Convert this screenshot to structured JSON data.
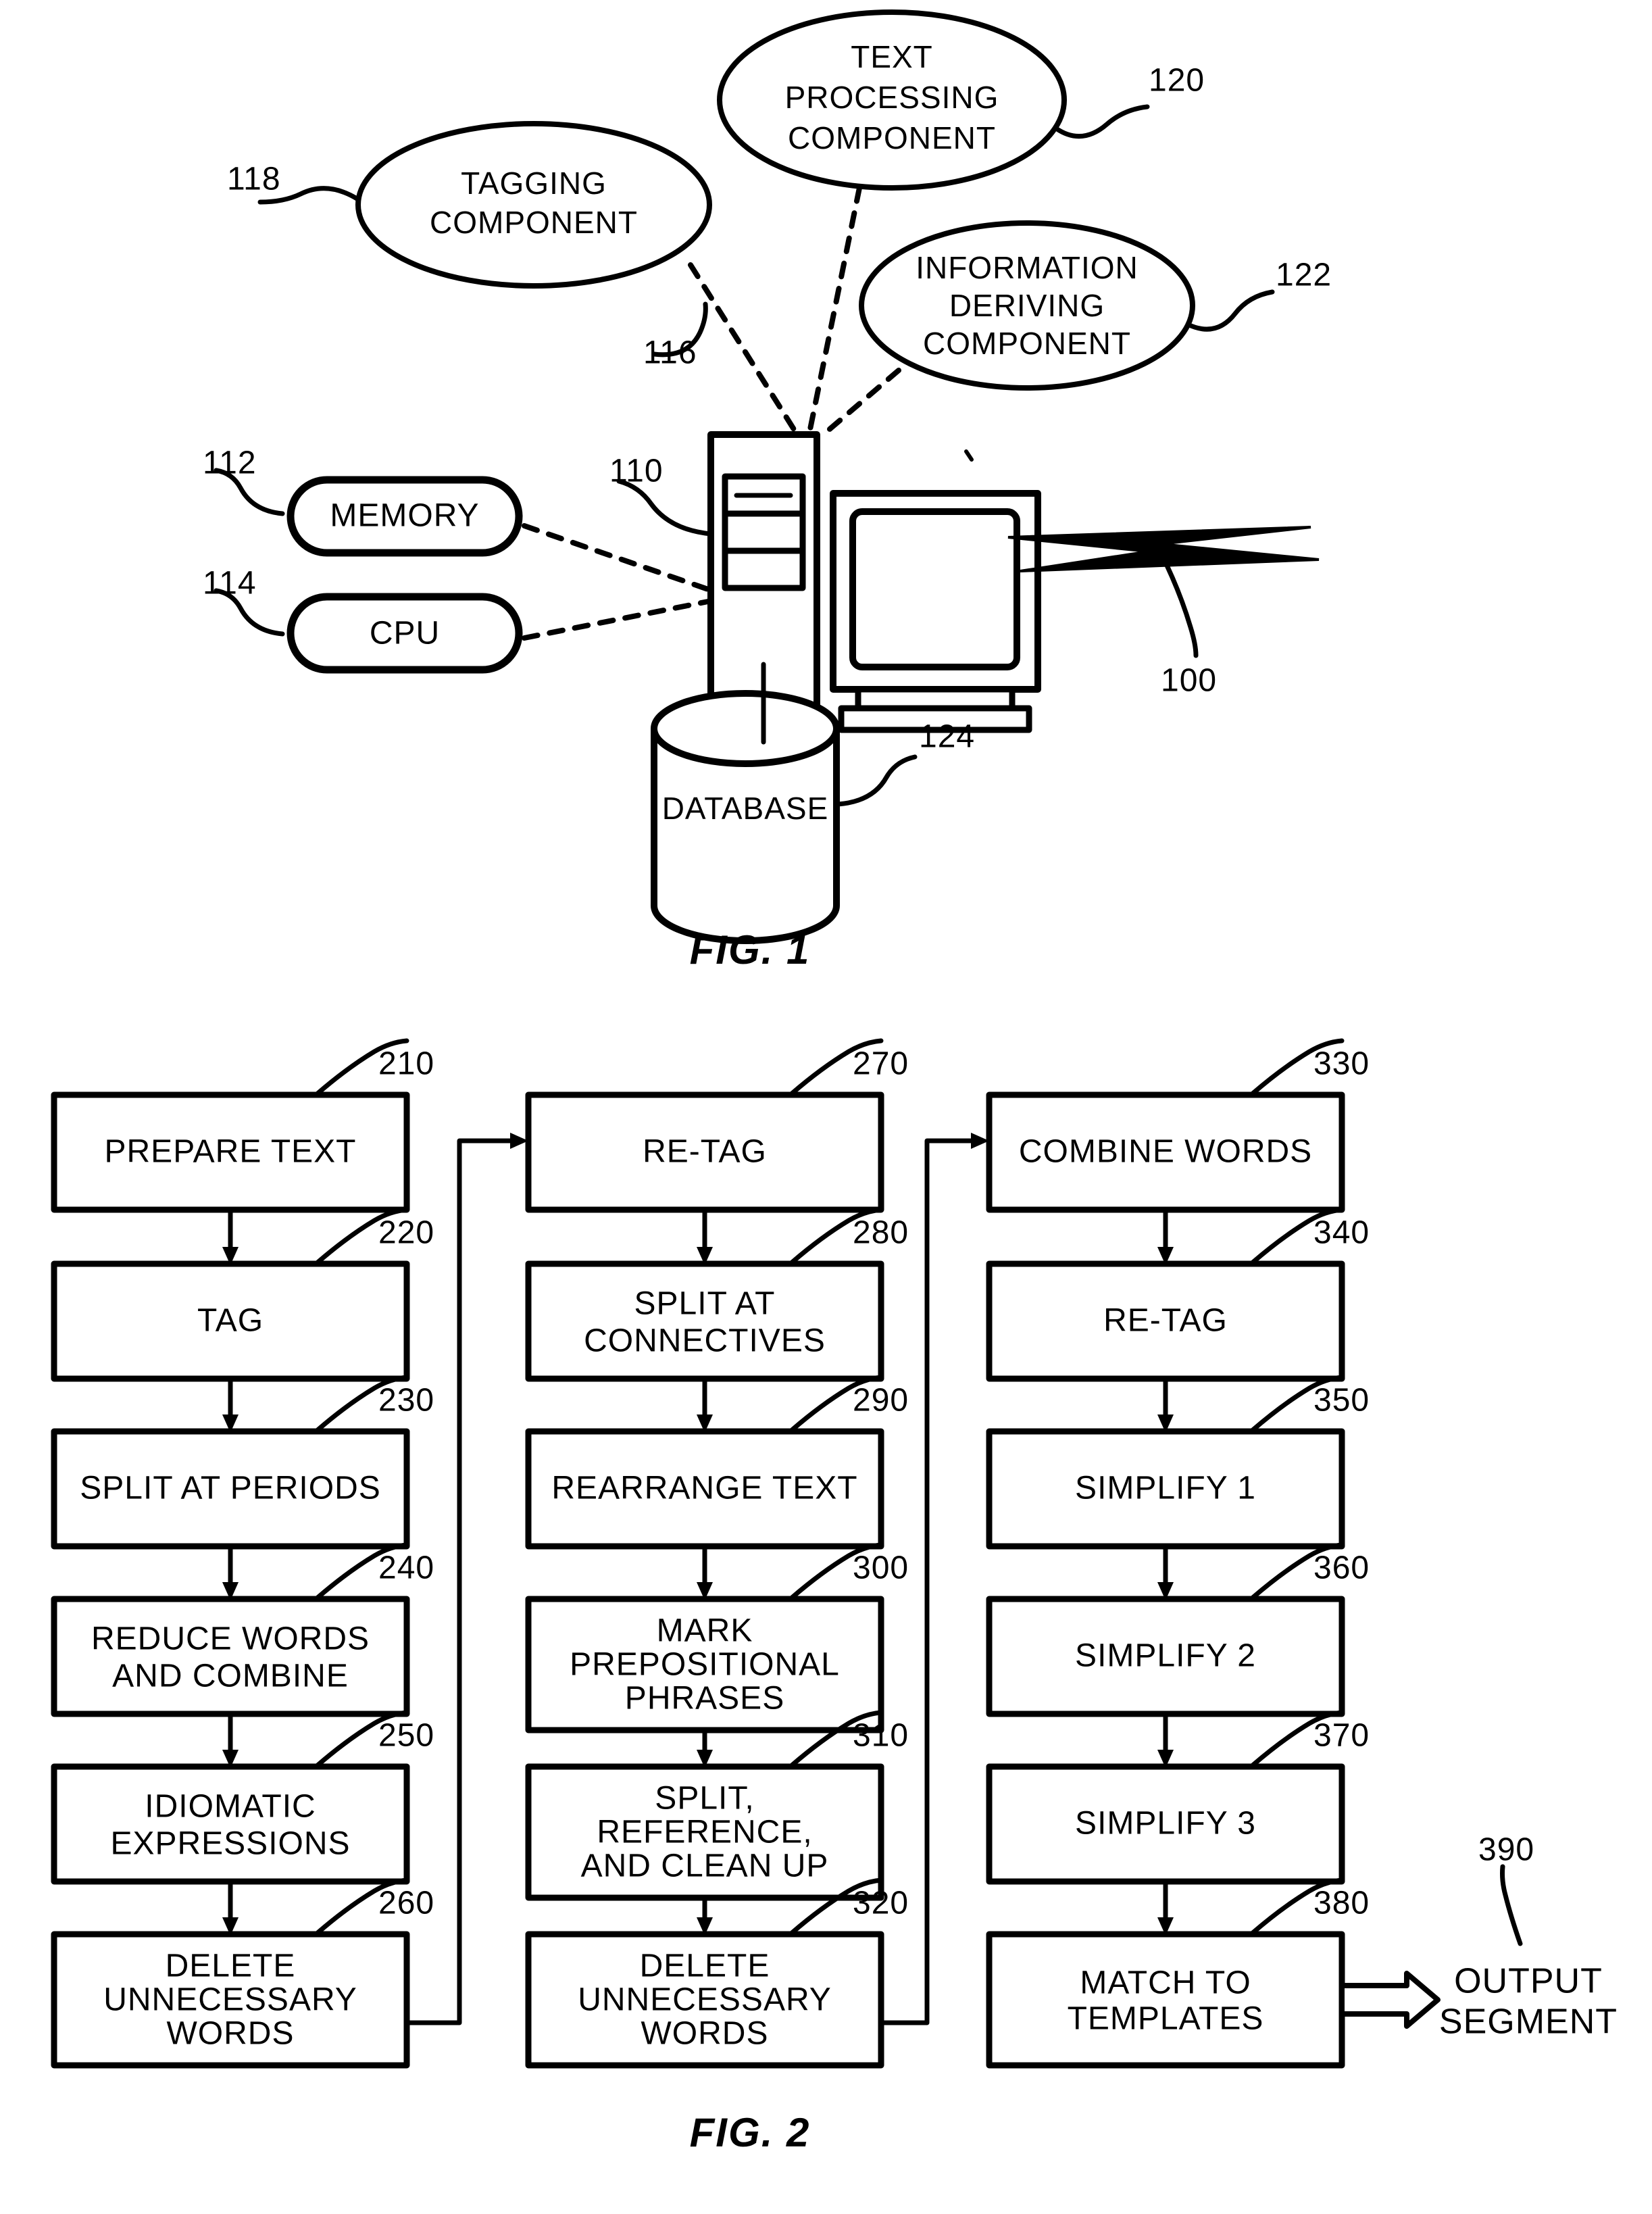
{
  "figure1": {
    "caption": "FIG. 1",
    "system_ref": "100",
    "nodes": {
      "tagging_component": {
        "label_line1": "TAGGING",
        "label_line2": "COMPONENT",
        "ref": "118"
      },
      "text_processing_component": {
        "label_line1": "TEXT",
        "label_line2": "PROCESSING",
        "label_line3": "COMPONENT",
        "ref": "120"
      },
      "information_deriving_component": {
        "label_line1": "INFORMATION",
        "label_line2": "DERIVING",
        "label_line3": "COMPONENT",
        "ref": "122"
      },
      "memory": {
        "label": "MEMORY",
        "ref": "112"
      },
      "cpu": {
        "label": "CPU",
        "ref": "114"
      },
      "computer": {
        "ref": "110"
      },
      "components_bundle": {
        "ref": "116"
      },
      "database": {
        "label": "DATABASE",
        "ref": "124"
      }
    }
  },
  "figure2": {
    "caption": "FIG. 2",
    "output": {
      "label_line1": "OUTPUT",
      "label_line2": "SEGMENT",
      "ref": "390"
    },
    "columns": [
      {
        "name": "column-1",
        "steps": [
          {
            "ref": "210",
            "lines": [
              "PREPARE TEXT"
            ]
          },
          {
            "ref": "220",
            "lines": [
              "TAG"
            ]
          },
          {
            "ref": "230",
            "lines": [
              "SPLIT AT PERIODS"
            ]
          },
          {
            "ref": "240",
            "lines": [
              "REDUCE WORDS",
              "AND COMBINE"
            ]
          },
          {
            "ref": "250",
            "lines": [
              "IDIOMATIC",
              "EXPRESSIONS"
            ]
          },
          {
            "ref": "260",
            "lines": [
              "DELETE",
              "UNNECESSARY",
              "WORDS"
            ]
          }
        ]
      },
      {
        "name": "column-2",
        "steps": [
          {
            "ref": "270",
            "lines": [
              "RE-TAG"
            ]
          },
          {
            "ref": "280",
            "lines": [
              "SPLIT AT",
              "CONNECTIVES"
            ]
          },
          {
            "ref": "290",
            "lines": [
              "REARRANGE TEXT"
            ]
          },
          {
            "ref": "300",
            "lines": [
              "MARK",
              "PREPOSITIONAL",
              "PHRASES"
            ]
          },
          {
            "ref": "310",
            "lines": [
              "SPLIT,",
              "REFERENCE,",
              "AND CLEAN UP"
            ]
          },
          {
            "ref": "320",
            "lines": [
              "DELETE",
              "UNNECESSARY",
              "WORDS"
            ]
          }
        ]
      },
      {
        "name": "column-3",
        "steps": [
          {
            "ref": "330",
            "lines": [
              "COMBINE WORDS"
            ]
          },
          {
            "ref": "340",
            "lines": [
              "RE-TAG"
            ]
          },
          {
            "ref": "350",
            "lines": [
              "SIMPLIFY 1"
            ]
          },
          {
            "ref": "360",
            "lines": [
              "SIMPLIFY 2"
            ]
          },
          {
            "ref": "370",
            "lines": [
              "SIMPLIFY 3"
            ]
          },
          {
            "ref": "380",
            "lines": [
              "MATCH TO",
              "TEMPLATES"
            ]
          }
        ]
      }
    ]
  },
  "colors": {
    "ink": "#000000",
    "paper": "#ffffff"
  }
}
